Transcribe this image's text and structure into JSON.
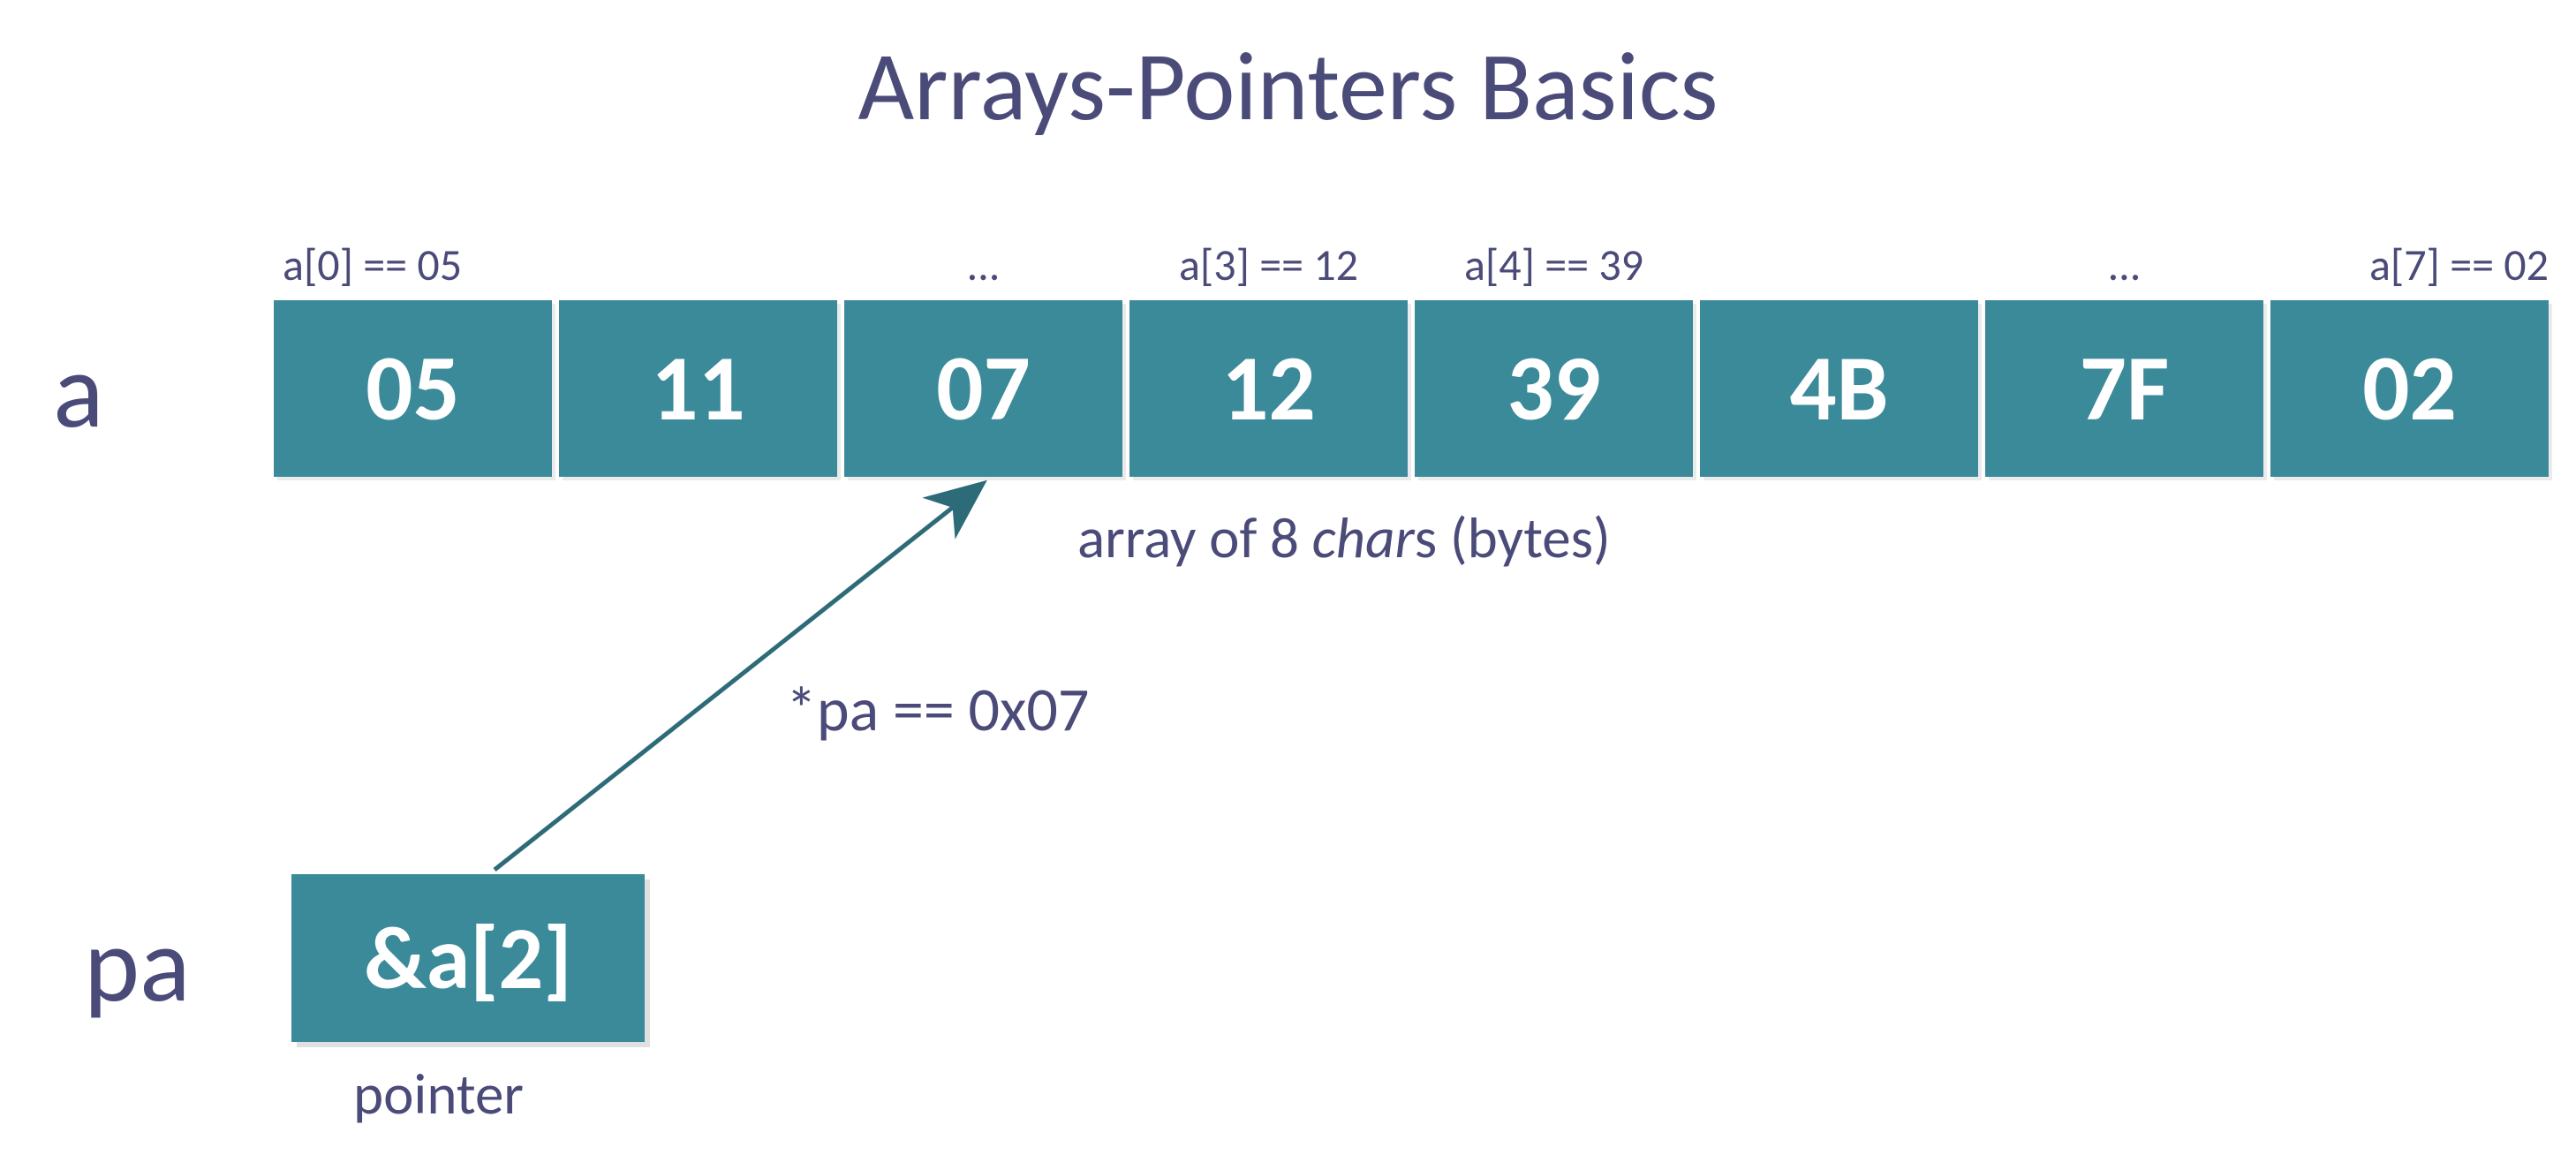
{
  "title": "Arrays-Pointers Basics",
  "array_label": "a",
  "pointer_label": "pa",
  "cells": [
    {
      "value": "05",
      "annot": "a[0] == 05",
      "annot_align": "left"
    },
    {
      "value": "11",
      "annot": "",
      "annot_align": "center"
    },
    {
      "value": "07",
      "annot": "...",
      "annot_align": "center"
    },
    {
      "value": "12",
      "annot": "a[3] == 12",
      "annot_align": "center"
    },
    {
      "value": "39",
      "annot": "a[4] == 39",
      "annot_align": "center"
    },
    {
      "value": "4B",
      "annot": "",
      "annot_align": "center"
    },
    {
      "value": "7F",
      "annot": "...",
      "annot_align": "center"
    },
    {
      "value": "02",
      "annot": "a[7] == 02",
      "annot_align": "right"
    }
  ],
  "array_caption_prefix": "array of 8 ",
  "array_caption_ital": "char",
  "array_caption_suffix": "s (bytes)",
  "pointer_value": "&a[2]",
  "pointer_caption": "pointer",
  "deref_text": "*pa == 0x07",
  "chart_data": {
    "type": "table",
    "title": "Arrays-Pointers Basics",
    "array_name": "a",
    "element_type": "char",
    "element_count": 8,
    "indices": [
      0,
      1,
      2,
      3,
      4,
      5,
      6,
      7
    ],
    "hex_values": [
      "05",
      "11",
      "07",
      "12",
      "39",
      "4B",
      "7F",
      "02"
    ],
    "index_annotations": [
      "a[0] == 05",
      "",
      "...",
      "a[3] == 12",
      "a[4] == 39",
      "",
      "...",
      "a[7] == 02"
    ],
    "pointer_name": "pa",
    "pointer_expr": "&a[2]",
    "pointer_target_index": 2,
    "dereference": "*pa == 0x07"
  }
}
